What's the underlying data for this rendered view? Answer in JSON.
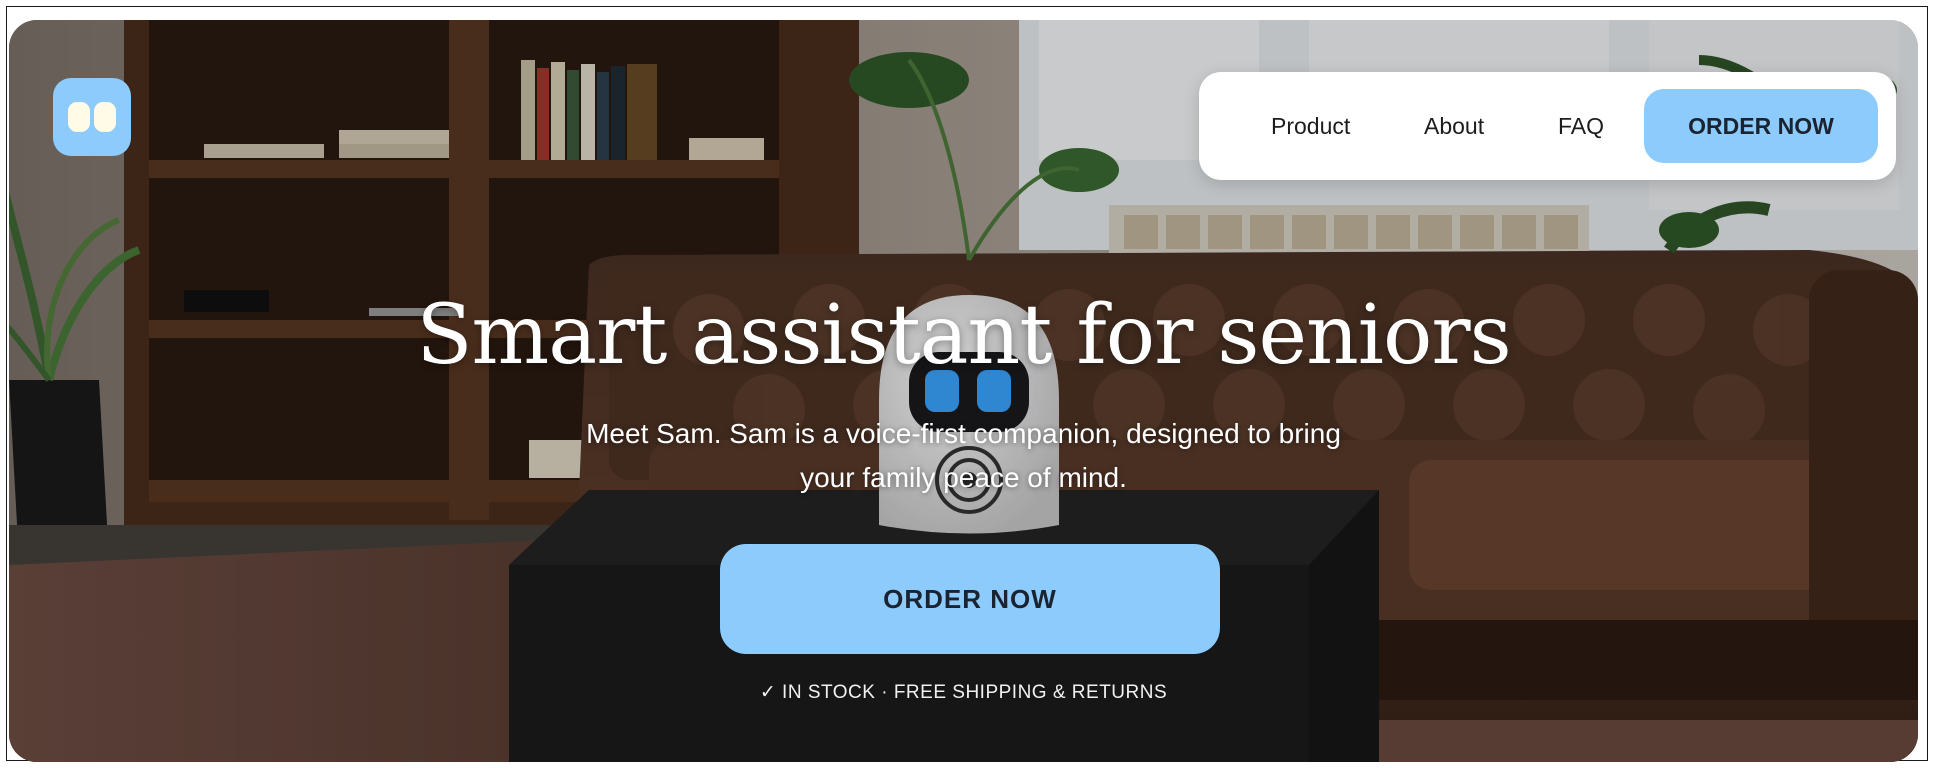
{
  "nav": {
    "links": [
      "Product",
      "About",
      "FAQ"
    ],
    "order_label": "ORDER NOW"
  },
  "hero": {
    "title": "Smart assistant for seniors",
    "subtitle_line1": "Meet Sam. Sam is a voice-first companion, designed to bring",
    "subtitle_line2": "your family peace of mind.",
    "cta_label": "ORDER NOW",
    "stock_note": "✓ IN STOCK · FREE SHIPPING & RETURNS"
  },
  "colors": {
    "accent": "#8ccbfb",
    "text_dark": "#1b2330",
    "white": "#ffffff"
  },
  "icons": {
    "logo": "robot-eyes-logo-icon"
  }
}
